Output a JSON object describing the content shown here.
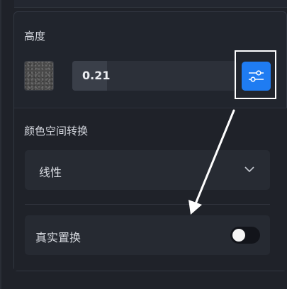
{
  "height_section": {
    "title": "高度",
    "value": "0.21",
    "value_fraction": 0.21,
    "settings_icon": "sliders-icon"
  },
  "color_space": {
    "title": "颜色空间转换",
    "selected": "线性",
    "chevron_icon": "chevron-down-icon"
  },
  "toggle_row": {
    "label": "真实置换",
    "enabled": false
  },
  "colors": {
    "accent": "#1f7cf2",
    "annotation": "#ffffff"
  }
}
